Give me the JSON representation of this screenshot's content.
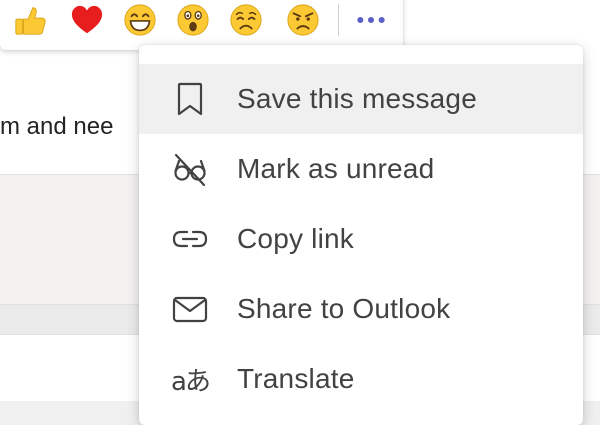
{
  "message": {
    "text": "m and nee"
  },
  "reaction_bar": {
    "reactions": [
      {
        "name": "like",
        "icon": "thumbs-up-icon"
      },
      {
        "name": "heart",
        "icon": "heart-icon"
      },
      {
        "name": "laugh",
        "icon": "laughing-face-icon"
      },
      {
        "name": "surprised",
        "icon": "surprised-face-icon"
      },
      {
        "name": "sad",
        "icon": "sad-face-icon"
      },
      {
        "name": "angry",
        "icon": "angry-face-icon"
      }
    ],
    "more_icon": "more-options-icon"
  },
  "context_menu": {
    "items": [
      {
        "label": "Save this message",
        "icon": "bookmark-icon"
      },
      {
        "label": "Mark as unread",
        "icon": "eye-off-icon"
      },
      {
        "label": "Copy link",
        "icon": "link-icon"
      },
      {
        "label": "Share to Outlook",
        "icon": "mail-icon"
      },
      {
        "label": "Translate",
        "icon": "translate-icon",
        "glyph": "aあ"
      }
    ]
  },
  "colors": {
    "accent": "#5b5fc7",
    "heart": "#e81e1e",
    "emoji_yellow": "#fcc934",
    "menu_highlight": "#f0f0f0",
    "text": "#424242"
  }
}
